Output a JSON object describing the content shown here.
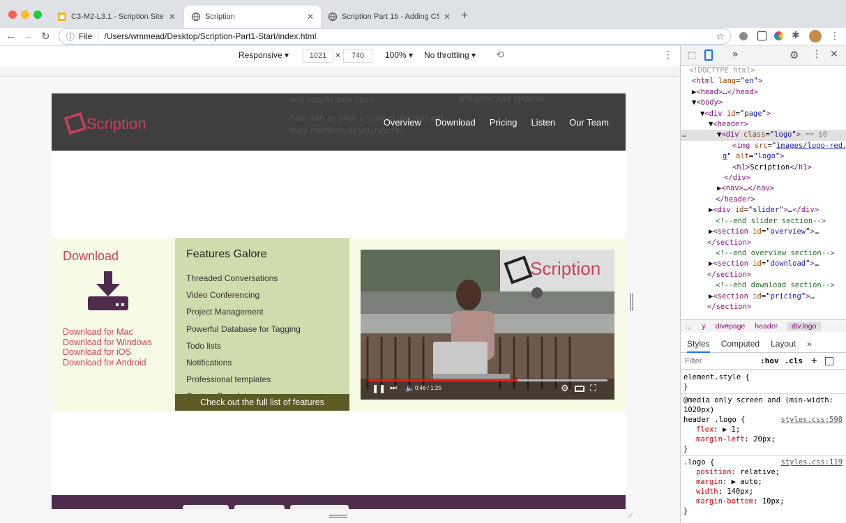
{
  "tabs": [
    {
      "title": "C3-M2-L3.1 - Scription Site - R",
      "active": false
    },
    {
      "title": "Scription",
      "active": true
    },
    {
      "title": "Scription Part 1b - Adding CSS",
      "active": false
    }
  ],
  "address": {
    "scheme_label": "File",
    "url": "/Users/wmmead/Desktop/Scription-Part1-Start/index.html"
  },
  "device_toolbar": {
    "mode": "Responsive",
    "width": "1021",
    "times": "×",
    "height": "740",
    "zoom": "100%",
    "throttle": "No throttling"
  },
  "site": {
    "ghost_text_1": "and easy to build upon.",
    "ghost_text_2": "Start with as small a team of one and add team members as you need to.",
    "ghost_text_3": "and grow your systems.",
    "logo_text": "Scription",
    "nav": [
      "Overview",
      "Download",
      "Pricing",
      "Listen",
      "Our Team"
    ],
    "download_heading": "Download",
    "download_links": [
      "Download for Mac",
      "Download for Windows",
      "Download for iOS",
      "Download for Android"
    ],
    "features_heading": "Features Galore",
    "features": [
      "Threaded Conversations",
      "Video Conferencing",
      "Project Management",
      "Powerful Database for Tagging",
      "Todo lists",
      "Notifications",
      "Professional templates",
      "Custom Templates"
    ],
    "features_button": "Check out the full list of features",
    "video_time": "0:46 / 1:25",
    "video_logo": "Scription"
  },
  "devtools": {
    "elements": [
      {
        "html": "<span class='cm' style='color:#999'>&lt;!DOCTYPE html&gt;</span>",
        "indent": 12
      },
      {
        "html": "<span class='tg'>&lt;html</span> <span class='at'>lang</span>=\"<span class='av'>en</span>\"<span class='tg'>&gt;</span>",
        "indent": 16
      },
      {
        "html": "▶<span class='tg'>&lt;head&gt;</span>…<span class='tg'>&lt;/head&gt;</span>",
        "indent": 16
      },
      {
        "html": "▼<span class='tg'>&lt;body&gt;</span>",
        "indent": 16
      },
      {
        "html": "▼<span class='tg'>&lt;div</span> <span class='at'>id</span>=\"<span class='av'>page</span>\"<span class='tg'>&gt;</span>",
        "indent": 28
      },
      {
        "html": "▼<span class='tg'>&lt;header&gt;</span>",
        "indent": 40
      },
      {
        "html": "▼<span class='tg'>&lt;div</span> <span class='at'>class</span>=\"<span class='av'>logo</span>\"<span class='tg'>&gt;</span> <span style='color:#888'>== $0</span>",
        "indent": 52,
        "selected": true
      },
      {
        "html": "<span class='tg'>&lt;img</span> <span class='at'>src</span>=\"<span class='lk'>images/logo-red.pn</span>",
        "indent": 74
      },
      {
        "html": "<span class='lk'>g</span>\" <span class='at'>alt</span>=\"<span class='av'>logo</span>\"<span class='tg'>&gt;</span>",
        "indent": 60
      },
      {
        "html": "<span class='tg'>&lt;h1&gt;</span>Scription<span class='tg'>&lt;/h1&gt;</span>",
        "indent": 74
      },
      {
        "html": "<span class='tg'>&lt;/div&gt;</span>",
        "indent": 62
      },
      {
        "html": "▶<span class='tg'>&lt;nav&gt;</span>…<span class='tg'>&lt;/nav&gt;</span>",
        "indent": 52
      },
      {
        "html": "<span class='tg'>&lt;/header&gt;</span>",
        "indent": 50
      },
      {
        "html": "▶<span class='tg'>&lt;div</span> <span class='at'>id</span>=\"<span class='av'>slider</span>\"<span class='tg'>&gt;</span>…<span class='tg'>&lt;/div&gt;</span>",
        "indent": 40
      },
      {
        "html": "<span class='cm'>&lt;!--end slider section--&gt;</span>",
        "indent": 50
      },
      {
        "html": "▶<span class='tg'>&lt;section</span> <span class='at'>id</span>=\"<span class='av'>overview</span>\"<span class='tg'>&gt;</span>…",
        "indent": 40
      },
      {
        "html": "<span class='tg'>&lt;/section&gt;</span>",
        "indent": 38
      },
      {
        "html": "<span class='cm'>&lt;!--end overview section--&gt;</span>",
        "indent": 50
      },
      {
        "html": "▶<span class='tg'>&lt;section</span> <span class='at'>id</span>=\"<span class='av'>download</span>\"<span class='tg'>&gt;</span>…",
        "indent": 40
      },
      {
        "html": "<span class='tg'>&lt;/section&gt;</span>",
        "indent": 38
      },
      {
        "html": "<span class='cm'>&lt;!--end download section--&gt;</span>",
        "indent": 50
      },
      {
        "html": "▶<span class='tg'>&lt;section</span> <span class='at'>id</span>=\"<span class='av'>pricing</span>\"<span class='tg'>&gt;</span>…",
        "indent": 40
      },
      {
        "html": "<span class='tg'>&lt;/section&gt;</span>",
        "indent": 38
      }
    ],
    "crumbs": [
      "…",
      "y",
      "div#page",
      "header",
      "div.logo"
    ],
    "style_tabs": [
      "Styles",
      "Computed",
      "Layout",
      "»"
    ],
    "filter_placeholder": "Filter",
    "hov": ":hov",
    "cls": ".cls",
    "rules": [
      {
        "selector": "element.style {",
        "source": "",
        "props": [],
        "close": "}"
      },
      {
        "selector": "@media only screen and (min-width: 1020px)",
        "selector2": "header .logo {",
        "source": "styles.css:598",
        "props": [
          [
            "flex",
            "▶ 1;"
          ],
          [
            "margin-left",
            "20px;"
          ]
        ],
        "close": "}"
      },
      {
        "selector": ".logo {",
        "source": "styles.css:119",
        "props": [
          [
            "position",
            "relative;"
          ],
          [
            "margin",
            "▶ auto;"
          ],
          [
            "width",
            "140px;"
          ],
          [
            "margin-bottom",
            "10px;"
          ]
        ],
        "close": "}"
      }
    ]
  },
  "colors": {
    "brand_red": "#c9405c",
    "header_bg": "#3f3f3f",
    "features_bg": "#cfdcad",
    "footer_bg": "#4d2c4e"
  }
}
